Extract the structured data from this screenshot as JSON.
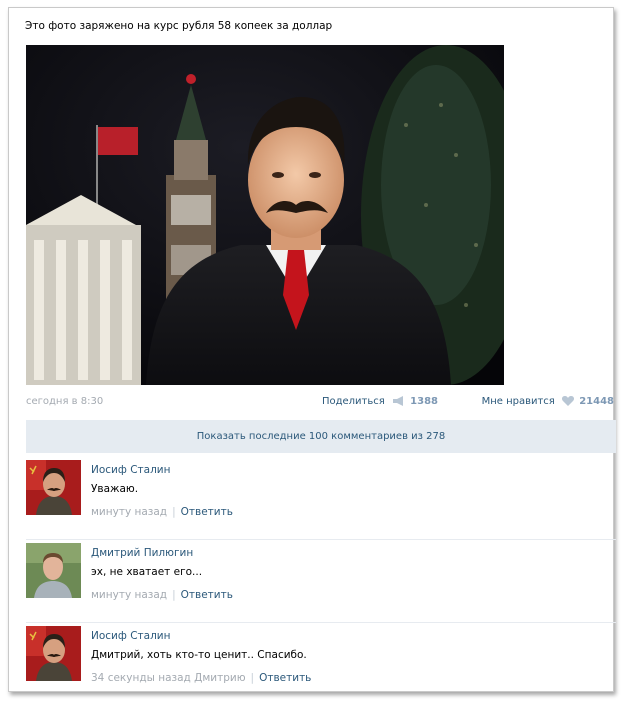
{
  "post": {
    "text": "Это фото заряжено на курс рубля 58 копеек за доллар",
    "time": "сегодня в 8:30",
    "share_label": "Поделиться",
    "share_count": "1388",
    "like_label": "Мне нравится",
    "like_count": "21448",
    "share_icon": "megaphone-icon",
    "like_icon": "heart-icon"
  },
  "show_more": "Показать последние 100 комментариев из 278",
  "comments": [
    {
      "author": "Иосиф Сталин",
      "text": "Уважаю.",
      "when": "минуту назад",
      "reply": "Ответить"
    },
    {
      "author": "Дмитрий Пилюгин",
      "text": "эх, не хватает его...",
      "when": "минуту назад",
      "reply": "Ответить"
    },
    {
      "author": "Иосиф Сталин",
      "text": "Дмитрий, хоть кто-то ценит.. Спасибо.",
      "when": "34 секунды назад Дмитрию",
      "reply": "Ответить"
    }
  ],
  "colors": {
    "link": "#2b587a",
    "muted": "#a4aab1",
    "count": "#7d98b4",
    "bar": "#e5ebf1"
  }
}
